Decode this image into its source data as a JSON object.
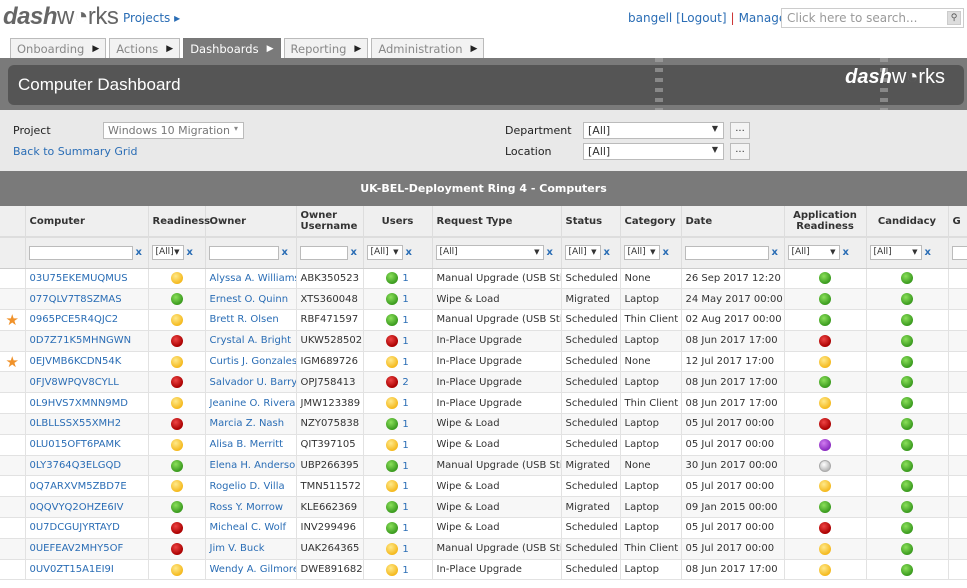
{
  "header": {
    "logo": "dashworks",
    "projects_label": "Projects",
    "user": "bangell",
    "logout": "[Logout]",
    "separator": "|",
    "manage": "Manage",
    "search_placeholder": "Click here to search..."
  },
  "tabs": [
    {
      "label": "Onboarding",
      "active": false
    },
    {
      "label": "Actions",
      "active": false
    },
    {
      "label": "Dashboards",
      "active": true
    },
    {
      "label": "Reporting",
      "active": false
    },
    {
      "label": "Administration",
      "active": false
    }
  ],
  "banner": {
    "title": "Computer Dashboard",
    "logo": "dashworks"
  },
  "filters": {
    "project_label": "Project",
    "project_value": "Windows 10 Migration",
    "back_link": "Back to Summary Grid",
    "department_label": "Department",
    "department_value": "[All]",
    "location_label": "Location",
    "location_value": "[All]",
    "more_label": "..."
  },
  "grid": {
    "title": "UK-BEL-Deployment Ring 4 - Computers",
    "columns": [
      "Computer",
      "Readiness",
      "Owner",
      "Owner Username",
      "Users",
      "Request Type",
      "Status",
      "Category",
      "Date",
      "Application Readiness",
      "Candidacy",
      "G"
    ],
    "filter_all": "[All]",
    "clear": "x",
    "status_colors": {
      "green": "#3a9a1e",
      "amber": "#f4b91e",
      "red": "#aa0000",
      "purple": "#8a2bc0",
      "grey": "#bbbbbb"
    },
    "rows": [
      {
        "star": false,
        "computer": "03U75EKEMUQMUS",
        "readiness": "amber",
        "owner": "Alyssa A. Williams",
        "username": "ABK350523",
        "users_status": "green",
        "users": "1",
        "request": "Manual Upgrade (USB Stick)",
        "status": "Scheduled",
        "category": "None",
        "date": "26 Sep 2017 12:20",
        "app": "green",
        "cand": "green"
      },
      {
        "star": false,
        "computer": "077QLV7T8SZMAS",
        "readiness": "green",
        "owner": "Ernest O. Quinn",
        "username": "XTS360048",
        "users_status": "green",
        "users": "1",
        "request": "Wipe & Load",
        "status": "Migrated",
        "category": "Laptop",
        "date": "24 May 2017 00:00",
        "app": "green",
        "cand": "green"
      },
      {
        "star": true,
        "computer": "0965PCE5R4QJC2",
        "readiness": "amber",
        "owner": "Brett R. Olsen",
        "username": "RBF471597",
        "users_status": "green",
        "users": "1",
        "request": "Manual Upgrade (USB Stick)",
        "status": "Scheduled",
        "category": "Thin Client",
        "date": "02 Aug 2017 00:00",
        "app": "green",
        "cand": "green"
      },
      {
        "star": false,
        "computer": "0D7Z71K5MHNGWN",
        "readiness": "red",
        "owner": "Crystal A. Bright",
        "username": "UKW528502",
        "users_status": "red",
        "users": "1",
        "request": "In-Place Upgrade",
        "status": "Scheduled",
        "category": "Laptop",
        "date": "08 Jun 2017 17:00",
        "app": "red",
        "cand": "green"
      },
      {
        "star": true,
        "computer": "0EJVMB6KCDN54K",
        "readiness": "amber",
        "owner": "Curtis J. Gonzales",
        "username": "IGM689726",
        "users_status": "amber",
        "users": "1",
        "request": "In-Place Upgrade",
        "status": "Scheduled",
        "category": "None",
        "date": "12 Jul 2017 17:00",
        "app": "amber",
        "cand": "green"
      },
      {
        "star": false,
        "computer": "0FJV8WPQV8CYLL",
        "readiness": "red",
        "owner": "Salvador U. Barry",
        "username": "OPJ758413",
        "users_status": "red",
        "users": "2",
        "request": "In-Place Upgrade",
        "status": "Scheduled",
        "category": "Laptop",
        "date": "08 Jun 2017 17:00",
        "app": "green",
        "cand": "green"
      },
      {
        "star": false,
        "computer": "0L9HVS7XMNN9MD",
        "readiness": "amber",
        "owner": "Jeanine O. Rivera",
        "username": "JMW123389",
        "users_status": "amber",
        "users": "1",
        "request": "In-Place Upgrade",
        "status": "Scheduled",
        "category": "Thin Client",
        "date": "08 Jun 2017 17:00",
        "app": "amber",
        "cand": "green"
      },
      {
        "star": false,
        "computer": "0LBLLSSX55XMH2",
        "readiness": "red",
        "owner": "Marcia Z. Nash",
        "username": "NZY075838",
        "users_status": "green",
        "users": "1",
        "request": "Wipe & Load",
        "status": "Scheduled",
        "category": "Laptop",
        "date": "05 Jul 2017 00:00",
        "app": "red",
        "cand": "green"
      },
      {
        "star": false,
        "computer": "0LU015OFT6PAMK",
        "readiness": "amber",
        "owner": "Alisa B. Merritt",
        "username": "QIT397105",
        "users_status": "amber",
        "users": "1",
        "request": "Wipe & Load",
        "status": "Scheduled",
        "category": "Laptop",
        "date": "05 Jul 2017 00:00",
        "app": "purple",
        "cand": "green"
      },
      {
        "star": false,
        "computer": "0LY3764Q3ELGQD",
        "readiness": "green",
        "owner": "Elena H. Anderson",
        "username": "UBP266395",
        "users_status": "green",
        "users": "1",
        "request": "Manual Upgrade (USB Stick)",
        "status": "Migrated",
        "category": "None",
        "date": "30 Jun 2017 00:00",
        "app": "grey",
        "cand": "green"
      },
      {
        "star": false,
        "computer": "0Q7ARXVM5ZBD7E",
        "readiness": "amber",
        "owner": "Rogelio D. Villa",
        "username": "TMN511572",
        "users_status": "amber",
        "users": "1",
        "request": "Wipe & Load",
        "status": "Scheduled",
        "category": "Laptop",
        "date": "05 Jul 2017 00:00",
        "app": "amber",
        "cand": "green"
      },
      {
        "star": false,
        "computer": "0QQVYQ2OHZE6IV",
        "readiness": "green",
        "owner": "Ross Y. Morrow",
        "username": "KLE662369",
        "users_status": "green",
        "users": "1",
        "request": "Wipe & Load",
        "status": "Migrated",
        "category": "Laptop",
        "date": "09 Jan 2015 00:00",
        "app": "green",
        "cand": "green"
      },
      {
        "star": false,
        "computer": "0U7DCGUJYRTAYD",
        "readiness": "red",
        "owner": "Micheal C. Wolf",
        "username": "INV299496",
        "users_status": "green",
        "users": "1",
        "request": "Wipe & Load",
        "status": "Scheduled",
        "category": "Laptop",
        "date": "05 Jul 2017 00:00",
        "app": "red",
        "cand": "green"
      },
      {
        "star": false,
        "computer": "0UEFEAV2MHY5OF",
        "readiness": "red",
        "owner": "Jim V. Buck",
        "username": "UAK264365",
        "users_status": "amber",
        "users": "1",
        "request": "Manual Upgrade (USB Stick)",
        "status": "Scheduled",
        "category": "Thin Client",
        "date": "05 Jul 2017 00:00",
        "app": "amber",
        "cand": "green"
      },
      {
        "star": false,
        "computer": "0UV0ZT15A1EI9I",
        "readiness": "amber",
        "owner": "Wendy A. Gilmore",
        "username": "DWE891682",
        "users_status": "amber",
        "users": "1",
        "request": "In-Place Upgrade",
        "status": "Scheduled",
        "category": "Laptop",
        "date": "08 Jun 2017 17:00",
        "app": "amber",
        "cand": "green"
      }
    ]
  }
}
